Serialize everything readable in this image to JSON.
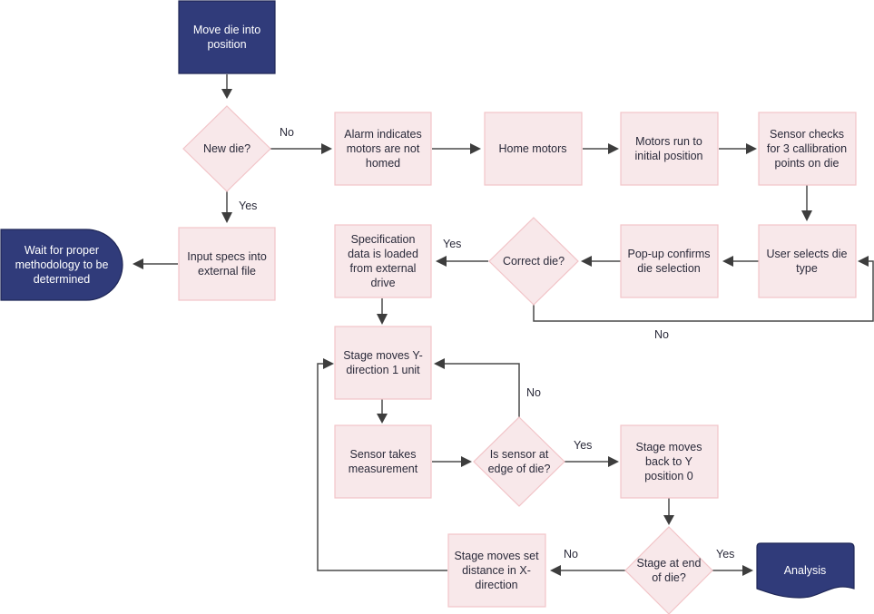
{
  "diagram": {
    "type": "flowchart",
    "colors": {
      "process_fill": "#f8e8ea",
      "process_border": "#f2c4c8",
      "terminal_fill": "#303b7a",
      "connector": "#4a4a4a"
    },
    "nodes": {
      "move_die": {
        "shape": "rect-dark",
        "lines": [
          "Move die into",
          "position"
        ]
      },
      "new_die": {
        "shape": "diamond",
        "lines": [
          "New die?"
        ]
      },
      "alarm": {
        "shape": "rect",
        "lines": [
          "Alarm indicates",
          "motors are not",
          "homed"
        ]
      },
      "home_motors": {
        "shape": "rect",
        "lines": [
          "Home motors"
        ]
      },
      "motors_run": {
        "shape": "rect",
        "lines": [
          "Motors run to",
          "initial position"
        ]
      },
      "sensor_checks": {
        "shape": "rect",
        "lines": [
          "Sensor checks",
          "for 3 callibration",
          "points on die"
        ]
      },
      "input_specs": {
        "shape": "rect",
        "lines": [
          "Input specs into",
          "external file"
        ]
      },
      "wait": {
        "shape": "delay-dark",
        "lines": [
          "Wait for proper",
          "methodology to be",
          "determined"
        ]
      },
      "spec_loaded": {
        "shape": "rect",
        "lines": [
          "Specification",
          "data is loaded",
          "from external",
          "drive"
        ]
      },
      "correct_die": {
        "shape": "diamond",
        "lines": [
          "Correct die?"
        ]
      },
      "popup": {
        "shape": "rect",
        "lines": [
          "Pop-up confirms",
          "die selection"
        ]
      },
      "user_selects": {
        "shape": "rect",
        "lines": [
          "User selects die",
          "type"
        ]
      },
      "stage_y": {
        "shape": "rect",
        "lines": [
          "Stage moves Y-",
          "direction 1 unit"
        ]
      },
      "sensor_meas": {
        "shape": "rect",
        "lines": [
          "Sensor takes",
          "measurement"
        ]
      },
      "edge_q": {
        "shape": "diamond",
        "lines": [
          "Is sensor at",
          "edge of die?"
        ]
      },
      "back_y0": {
        "shape": "rect",
        "lines": [
          "Stage moves",
          "back to Y",
          "position 0"
        ]
      },
      "end_q": {
        "shape": "diamond",
        "lines": [
          "Stage at end",
          "of die?"
        ]
      },
      "stage_x": {
        "shape": "rect",
        "lines": [
          "Stage moves set",
          "distance in X-",
          "direction"
        ]
      },
      "analysis": {
        "shape": "document-dark",
        "lines": [
          "Analysis"
        ]
      }
    },
    "edge_labels": {
      "new_die_no": "No",
      "new_die_yes": "Yes",
      "correct_yes": "Yes",
      "correct_no": "No",
      "edge_no": "No",
      "edge_yes": "Yes",
      "end_no": "No",
      "end_yes": "Yes"
    }
  }
}
